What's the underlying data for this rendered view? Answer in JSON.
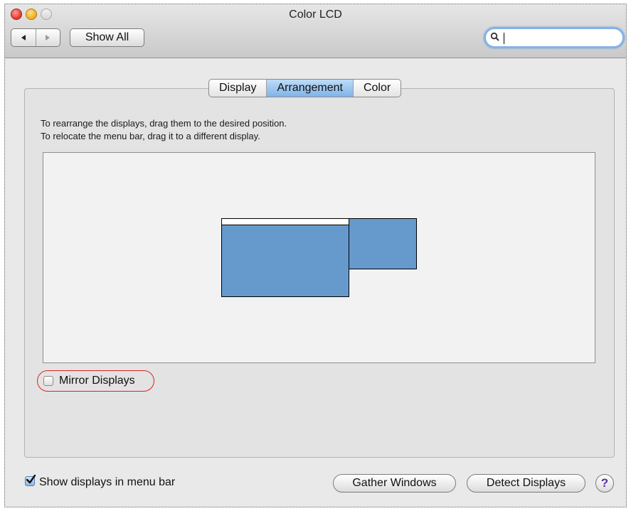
{
  "window": {
    "title": "Color LCD",
    "show_all_label": "Show All",
    "search": {
      "value": "",
      "placeholder": ""
    }
  },
  "tabs": [
    {
      "label": "Display",
      "active": false
    },
    {
      "label": "Arrangement",
      "active": true
    },
    {
      "label": "Color",
      "active": false
    }
  ],
  "arrangement": {
    "instruction_line1": "To rearrange the displays, drag them to the desired position.",
    "instruction_line2": "To relocate the menu bar, drag it to a different display.",
    "display_color": "#6699cc"
  },
  "mirror_displays": {
    "label": "Mirror Displays",
    "checked": false,
    "highlight_color": "#e02020"
  },
  "footer": {
    "show_in_menubar_label": "Show displays in menu bar",
    "show_in_menubar_checked": true,
    "gather_windows_label": "Gather Windows",
    "detect_displays_label": "Detect Displays",
    "help_label": "?"
  }
}
